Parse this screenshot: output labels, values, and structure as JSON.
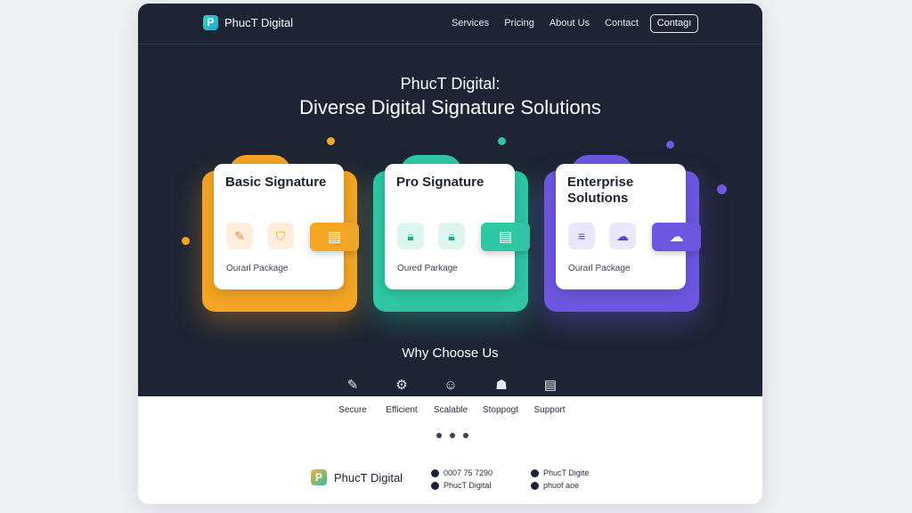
{
  "brand": {
    "name": "PhucT Digital",
    "logo_letter": "P"
  },
  "nav": {
    "items": [
      "Services",
      "Pricing",
      "About Us",
      "Contact"
    ],
    "cta": "Contagı"
  },
  "hero": {
    "title_line1": "PhucT Digital:",
    "title_line2": "Diverse Digital Signature Solutions"
  },
  "plans": [
    {
      "title": "Basic Signature",
      "package": "Ourarl Package",
      "color": "#f5a524",
      "icons": [
        "pen-icon",
        "shield-icon"
      ],
      "action_icon": "document-edit-icon"
    },
    {
      "title": "Pro Signature",
      "package": "Oured Parkage",
      "color": "#2fc7a3",
      "icons": [
        "lock-icon",
        "lock-icon"
      ],
      "action_icon": "document-search-icon"
    },
    {
      "title": "Enterprise Solutions",
      "package": "Ourarl Package",
      "color": "#6e57e0",
      "icons": [
        "list-icon",
        "cloud-download-icon"
      ],
      "action_icon": "cloud-upload-icon"
    }
  ],
  "why": {
    "title": "Why Choose Us",
    "features": [
      {
        "label": "Secure",
        "icon": "pen-icon"
      },
      {
        "label": "Efficient",
        "icon": "gear-icon"
      },
      {
        "label": "Scalable",
        "icon": "user-icon"
      },
      {
        "label": "Stoppogt",
        "icon": "support-icon"
      },
      {
        "label": "Support",
        "icon": "document-icon"
      }
    ]
  },
  "footer": {
    "brand": "PhucT Digital",
    "phone": "0007 75 7290",
    "handle": "PhucT Digital",
    "social1": "PhucT Digite",
    "social2": "phuof aoe"
  }
}
